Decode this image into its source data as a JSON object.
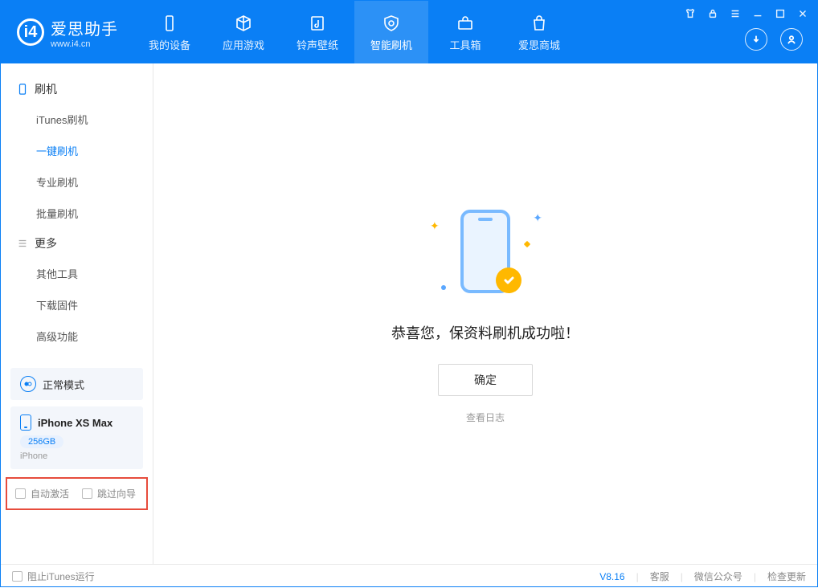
{
  "app": {
    "title": "爱思助手",
    "subtitle": "www.i4.cn"
  },
  "nav": {
    "device": "我的设备",
    "apps": "应用游戏",
    "ringtones": "铃声壁纸",
    "flash": "智能刷机",
    "toolbox": "工具箱",
    "store": "爱思商城"
  },
  "sidebar": {
    "flash_head": "刷机",
    "itunes_flash": "iTunes刷机",
    "one_click_flash": "一键刷机",
    "pro_flash": "专业刷机",
    "batch_flash": "批量刷机",
    "more_head": "更多",
    "other_tools": "其他工具",
    "download_fw": "下载固件",
    "advanced": "高级功能"
  },
  "device_panel": {
    "mode": "正常模式",
    "name": "iPhone XS Max",
    "capacity": "256GB",
    "type": "iPhone"
  },
  "options": {
    "auto_activate": "自动激活",
    "skip_guide": "跳过向导"
  },
  "main": {
    "success_title": "恭喜您，保资料刷机成功啦！",
    "ok_button": "确定",
    "view_log": "查看日志"
  },
  "footer": {
    "block_itunes": "阻止iTunes运行",
    "version": "V8.16",
    "support": "客服",
    "wechat": "微信公众号",
    "check_update": "检查更新"
  }
}
